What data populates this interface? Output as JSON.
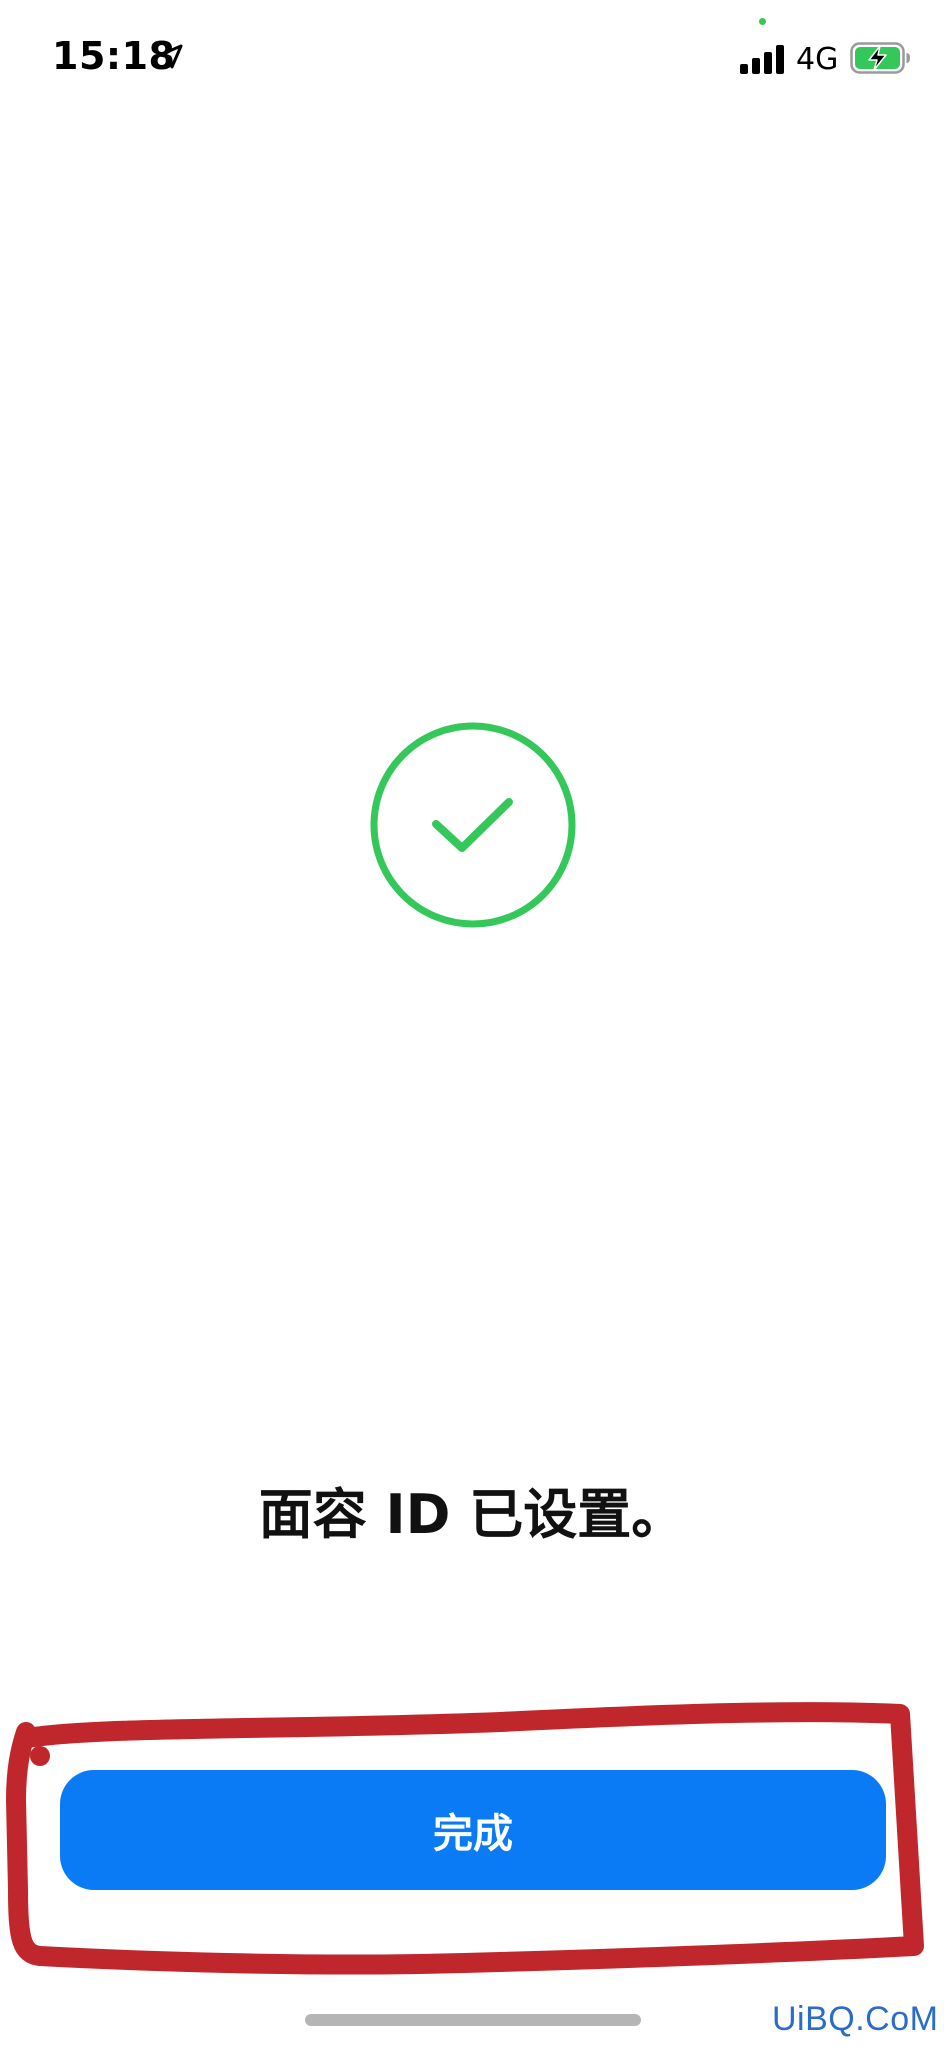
{
  "status_bar": {
    "time": "15:18",
    "network": "4G",
    "icons": [
      "location-arrow-icon",
      "signal-bars-icon",
      "battery-charging-icon"
    ],
    "battery_color": "#34c759"
  },
  "success": {
    "icon": "checkmark-circle-icon",
    "color": "#34c759"
  },
  "title": "面容 ID 已设置。",
  "done_button": {
    "label": "完成",
    "color": "#0a7bf5"
  },
  "annotation": {
    "color": "#c0272d"
  },
  "watermark": "UiBQ.CoM"
}
